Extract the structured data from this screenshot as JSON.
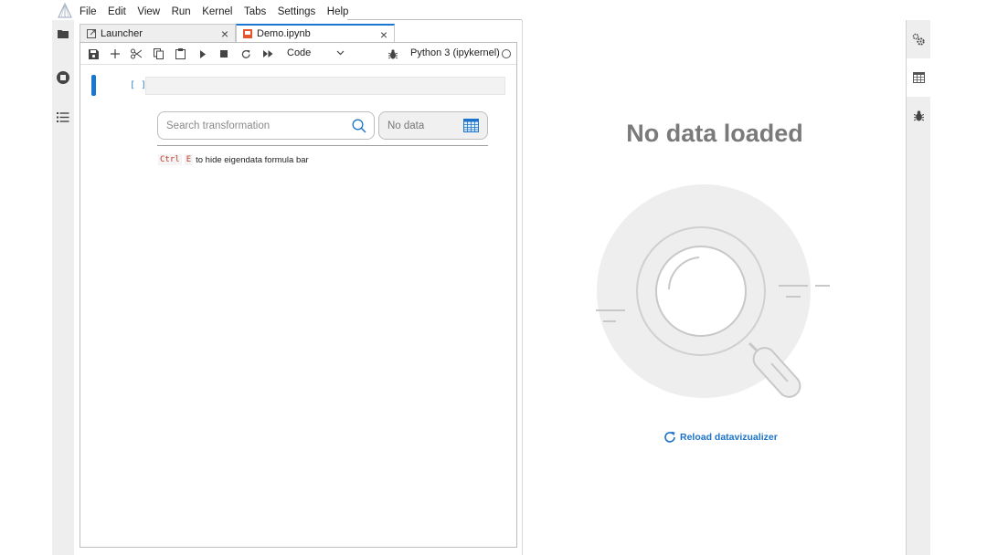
{
  "menubar": {
    "items": [
      "File",
      "Edit",
      "View",
      "Run",
      "Kernel",
      "Tabs",
      "Settings",
      "Help"
    ]
  },
  "tabs": [
    {
      "label": "Launcher",
      "close": "×",
      "active": false
    },
    {
      "label": "Demo.ipynb",
      "close": "×",
      "active": true
    }
  ],
  "toolbar": {
    "cell_type": "Code",
    "kernel": "Python 3 (ipykernel)"
  },
  "cell": {
    "prompt": "[ ]:"
  },
  "eigendata": {
    "search_placeholder": "Search transformation",
    "no_data": "No data",
    "hint_key1": "Ctrl",
    "hint_key2": "E",
    "hint_text": "to hide eigendata formula bar"
  },
  "viz": {
    "title": "No data loaded",
    "reload_label": "Reload datavizualizer"
  },
  "colors": {
    "accent": "#1976d2",
    "link": "#1a73c8",
    "title_gray": "#7a7a7a"
  }
}
